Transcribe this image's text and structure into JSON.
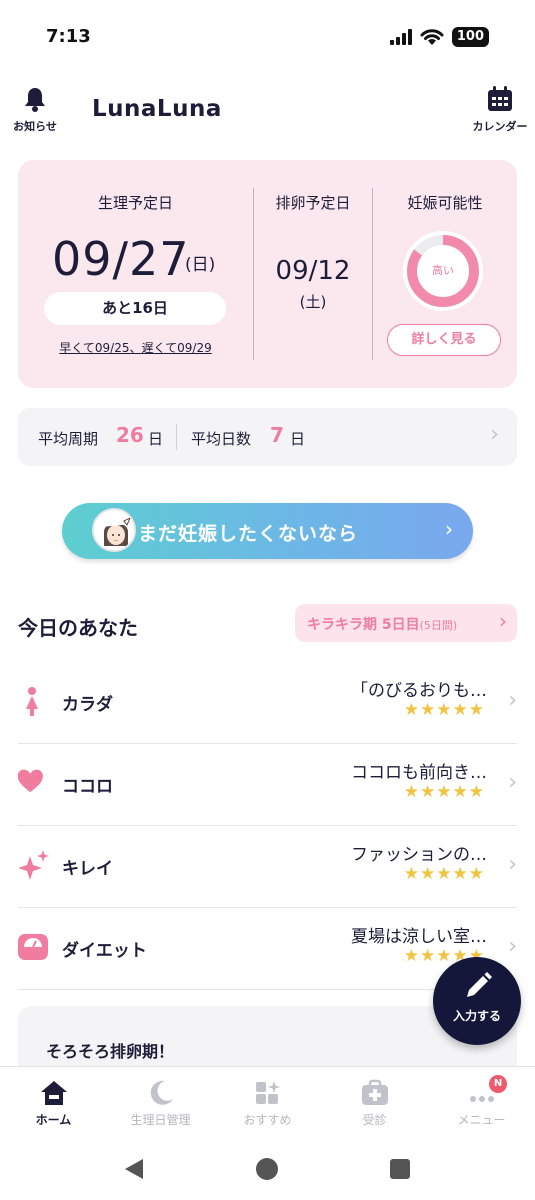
{
  "status_bar": {
    "time": "7:13",
    "battery": "100"
  },
  "header": {
    "notifications_label": "お知らせ",
    "logo": "LunaLuna",
    "calendar_label": "カレンダー"
  },
  "cycle": {
    "period": {
      "label": "生理予定日",
      "date": "09/27",
      "weekday": "(日)",
      "countdown": "あと16日",
      "range": "早くて09/25、遅くて09/29"
    },
    "ovulation": {
      "label": "排卵予定日",
      "date": "09/12",
      "weekday": "(土)"
    },
    "fertility": {
      "label": "妊娠可能性",
      "level": "高い",
      "ring_fill": 0.85,
      "detail_button": "詳しく見る"
    }
  },
  "averages": {
    "cycle_label": "平均周期",
    "cycle_value": "26",
    "cycle_unit": "日",
    "duration_label": "平均日数",
    "duration_value": "7",
    "duration_unit": "日"
  },
  "banner": {
    "text": "まだ妊娠したくないなら"
  },
  "today": {
    "title": "今日のあなた",
    "phase_name": "キラキラ期 5日目",
    "phase_length": "(5日間)",
    "rows": [
      {
        "label": "カラダ",
        "text": "「のびるおりも…",
        "stars": "★★★★★",
        "icon": "woman-icon",
        "rating": 5
      },
      {
        "label": "ココロ",
        "text": "ココロも前向き…",
        "stars": "★★★★★",
        "icon": "heart-icon",
        "rating": 5
      },
      {
        "label": "キレイ",
        "text": "ファッションの…",
        "stars": "★★★★★",
        "icon": "sparkle-icon",
        "rating": 5
      },
      {
        "label": "ダイエット",
        "text": "夏場は涼しい室…",
        "stars": "★★★★★",
        "icon": "scale-icon",
        "rating": 5
      }
    ]
  },
  "teaser": {
    "title": "そろそろ排卵期！"
  },
  "fab": {
    "label": "入力する"
  },
  "bottom_nav": {
    "items": [
      {
        "label": "ホーム",
        "icon": "home-icon",
        "active": true
      },
      {
        "label": "生理日管理",
        "icon": "moon-icon",
        "active": false
      },
      {
        "label": "おすすめ",
        "icon": "grid-sparkle-icon",
        "active": false
      },
      {
        "label": "受診",
        "icon": "medical-kit-icon",
        "active": false
      },
      {
        "label": "メニュー",
        "icon": "more-icon",
        "active": false,
        "badge": "N"
      }
    ]
  },
  "colors": {
    "accent_pink": "#f07ca0",
    "navy": "#1d1d3a",
    "card_pink": "#fbe8ee",
    "star_yellow": "#f2c340"
  }
}
